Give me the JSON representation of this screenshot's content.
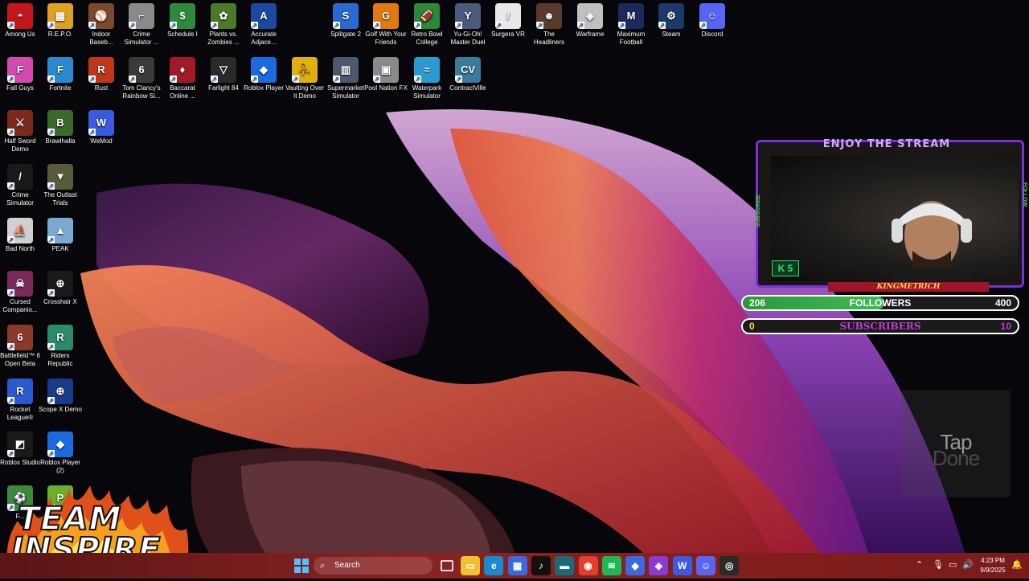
{
  "desktop": {
    "icons": [
      {
        "label": "Among Us",
        "color": "#c2161c",
        "glyph": "◓"
      },
      {
        "label": "R.E.P.O.",
        "color": "#e0a020",
        "glyph": "▦"
      },
      {
        "label": "Indoor Baseb...",
        "color": "#7a4a2a",
        "glyph": "⚾"
      },
      {
        "label": "Crime Simulator ...",
        "color": "#8a8a8a",
        "glyph": "⌐"
      },
      {
        "label": "Schedule I",
        "color": "#2d8a3a",
        "glyph": "$"
      },
      {
        "label": "Plants vs. Zombies ...",
        "color": "#4a7a2a",
        "glyph": "✿"
      },
      {
        "label": "Accurate Adjace...",
        "color": "#1a4aa0",
        "glyph": "A"
      },
      {
        "label": "Splitgate 2",
        "color": "#2a6ad0",
        "glyph": "S"
      },
      {
        "label": "Golf With Your Friends",
        "color": "#e07a10",
        "glyph": "G"
      },
      {
        "label": "Retro Bowl College",
        "color": "#2a8a3a",
        "glyph": "🏈"
      },
      {
        "label": "Yu-Gi-Oh! Master Duel",
        "color": "#4a5a7a",
        "glyph": "Y"
      },
      {
        "label": "Surgera VR",
        "color": "#e8e8e8",
        "glyph": "/"
      },
      {
        "label": "The Headliners",
        "color": "#5a3a2a",
        "glyph": "☻"
      },
      {
        "label": "Warframe",
        "color": "#c0c0c0",
        "glyph": "◈"
      },
      {
        "label": "Maximum Football",
        "color": "#1a2a5a",
        "glyph": "M"
      },
      {
        "label": "Steam",
        "color": "#1a3a6a",
        "glyph": "⚙"
      },
      {
        "label": "Discord",
        "color": "#5865f2",
        "glyph": "☺"
      },
      {
        "label": "Fall Guys",
        "color": "#d04ab0",
        "glyph": "F"
      },
      {
        "label": "Fortnite",
        "color": "#2a8ad0",
        "glyph": "F"
      },
      {
        "label": "Rust",
        "color": "#c0361c",
        "glyph": "R"
      },
      {
        "label": "Tom Clancy's Rainbow Si...",
        "color": "#3a3a3a",
        "glyph": "6"
      },
      {
        "label": "Baccarat Online ...",
        "color": "#a01a2a",
        "glyph": "♦"
      },
      {
        "label": "Farlight 84",
        "color": "#2a2a2a",
        "glyph": "▽"
      },
      {
        "label": "Roblox Player",
        "color": "#1a6ae0",
        "glyph": "◆"
      },
      {
        "label": "Vaulting Over It Demo",
        "color": "#e0b010",
        "glyph": "⛹"
      },
      {
        "label": "Supermarket Simulator",
        "color": "#4a5a6a",
        "glyph": "▥"
      },
      {
        "label": "Pool Nation FX",
        "color": "#8a8a8a",
        "glyph": "▣"
      },
      {
        "label": "Waterpark Simulator",
        "color": "#2a9ad0",
        "glyph": "≈"
      },
      {
        "label": "ContractVille",
        "color": "#3a7a9a",
        "glyph": "CV"
      },
      {
        "label": "Half Sword Demo",
        "color": "#7a2a1a",
        "glyph": "⚔"
      },
      {
        "label": "Brawlhalla",
        "color": "#3a6a2a",
        "glyph": "B"
      },
      {
        "label": "WeMod",
        "color": "#3a5ae0",
        "glyph": "W"
      },
      {
        "label": "Crime Simulator",
        "color": "#1a1a1a",
        "glyph": "/"
      },
      {
        "label": "The Outlast Trials",
        "color": "#5a5a3a",
        "glyph": "▼"
      },
      {
        "label": "Bad North",
        "color": "#d0d0d0",
        "glyph": "⛵"
      },
      {
        "label": "PEAK",
        "color": "#7aaad0",
        "glyph": "▲"
      },
      {
        "label": "Cursed Companio...",
        "color": "#7a2a5a",
        "glyph": "☠"
      },
      {
        "label": "Crosshair X",
        "color": "#1a1a1a",
        "glyph": "⊕"
      },
      {
        "label": "Battlefield™ 6 Open Beta",
        "color": "#8a3a2a",
        "glyph": "6"
      },
      {
        "label": "Riders Republic",
        "color": "#2a8a6a",
        "glyph": "R"
      },
      {
        "label": "Rocket League®",
        "color": "#2a5ad0",
        "glyph": "R"
      },
      {
        "label": "Scope X Demo",
        "color": "#1a3a8a",
        "glyph": "⊕"
      },
      {
        "label": "Roblox Studio",
        "color": "#1a1a1a",
        "glyph": "◩"
      },
      {
        "label": "Roblox Player (2)",
        "color": "#1a6ae0",
        "glyph": "◆"
      },
      {
        "label": "F...",
        "color": "#3a8a3a",
        "glyph": "⚽"
      },
      {
        "label": "",
        "color": "#6ab02a",
        "glyph": "P"
      }
    ]
  },
  "stream_overlay": {
    "title": "ENJOY THE STREAM",
    "badge": "K 5",
    "streamer_name": "KINGMETRICH",
    "side_left": "SUBSCRIBE",
    "side_right": "FOLLOW",
    "followers": {
      "current": "206",
      "label": "FOLLOWERS",
      "goal": "400",
      "progress": 0.515,
      "color": "#3dbb55"
    },
    "subscribers": {
      "current": "0",
      "label": "SUBSCRIBERS",
      "goal": "10",
      "progress": 0.0,
      "color": "#c23ad8"
    }
  },
  "tap_widget": {
    "line1": "Tap",
    "line2": "Done"
  },
  "team_logo": {
    "line1": "TEAM",
    "line2": "INSPIRE"
  },
  "taskbar": {
    "search_placeholder": "Search",
    "clock_time": "4:23 PM",
    "clock_date": "9/9/2025",
    "pinned": [
      {
        "name": "file-explorer",
        "color": "#f0c030",
        "glyph": "▭"
      },
      {
        "name": "edge",
        "color": "#1a8ad0",
        "glyph": "e"
      },
      {
        "name": "store",
        "color": "#3a6ae0",
        "glyph": "▦"
      },
      {
        "name": "tiktok",
        "color": "#111111",
        "glyph": "♪"
      },
      {
        "name": "app-teal",
        "color": "#1a6a7a",
        "glyph": "▬"
      },
      {
        "name": "chrome",
        "color": "#e0402a",
        "glyph": "◉"
      },
      {
        "name": "spotify",
        "color": "#1db954",
        "glyph": "≋"
      },
      {
        "name": "roblox",
        "color": "#3a6ae0",
        "glyph": "◆"
      },
      {
        "name": "app-purple",
        "color": "#8a3ad0",
        "glyph": "◈"
      },
      {
        "name": "wemod",
        "color": "#3a5ae0",
        "glyph": "W"
      },
      {
        "name": "discord",
        "color": "#5865f2",
        "glyph": "☺"
      },
      {
        "name": "obs",
        "color": "#2a2a2a",
        "glyph": "◎"
      }
    ]
  }
}
